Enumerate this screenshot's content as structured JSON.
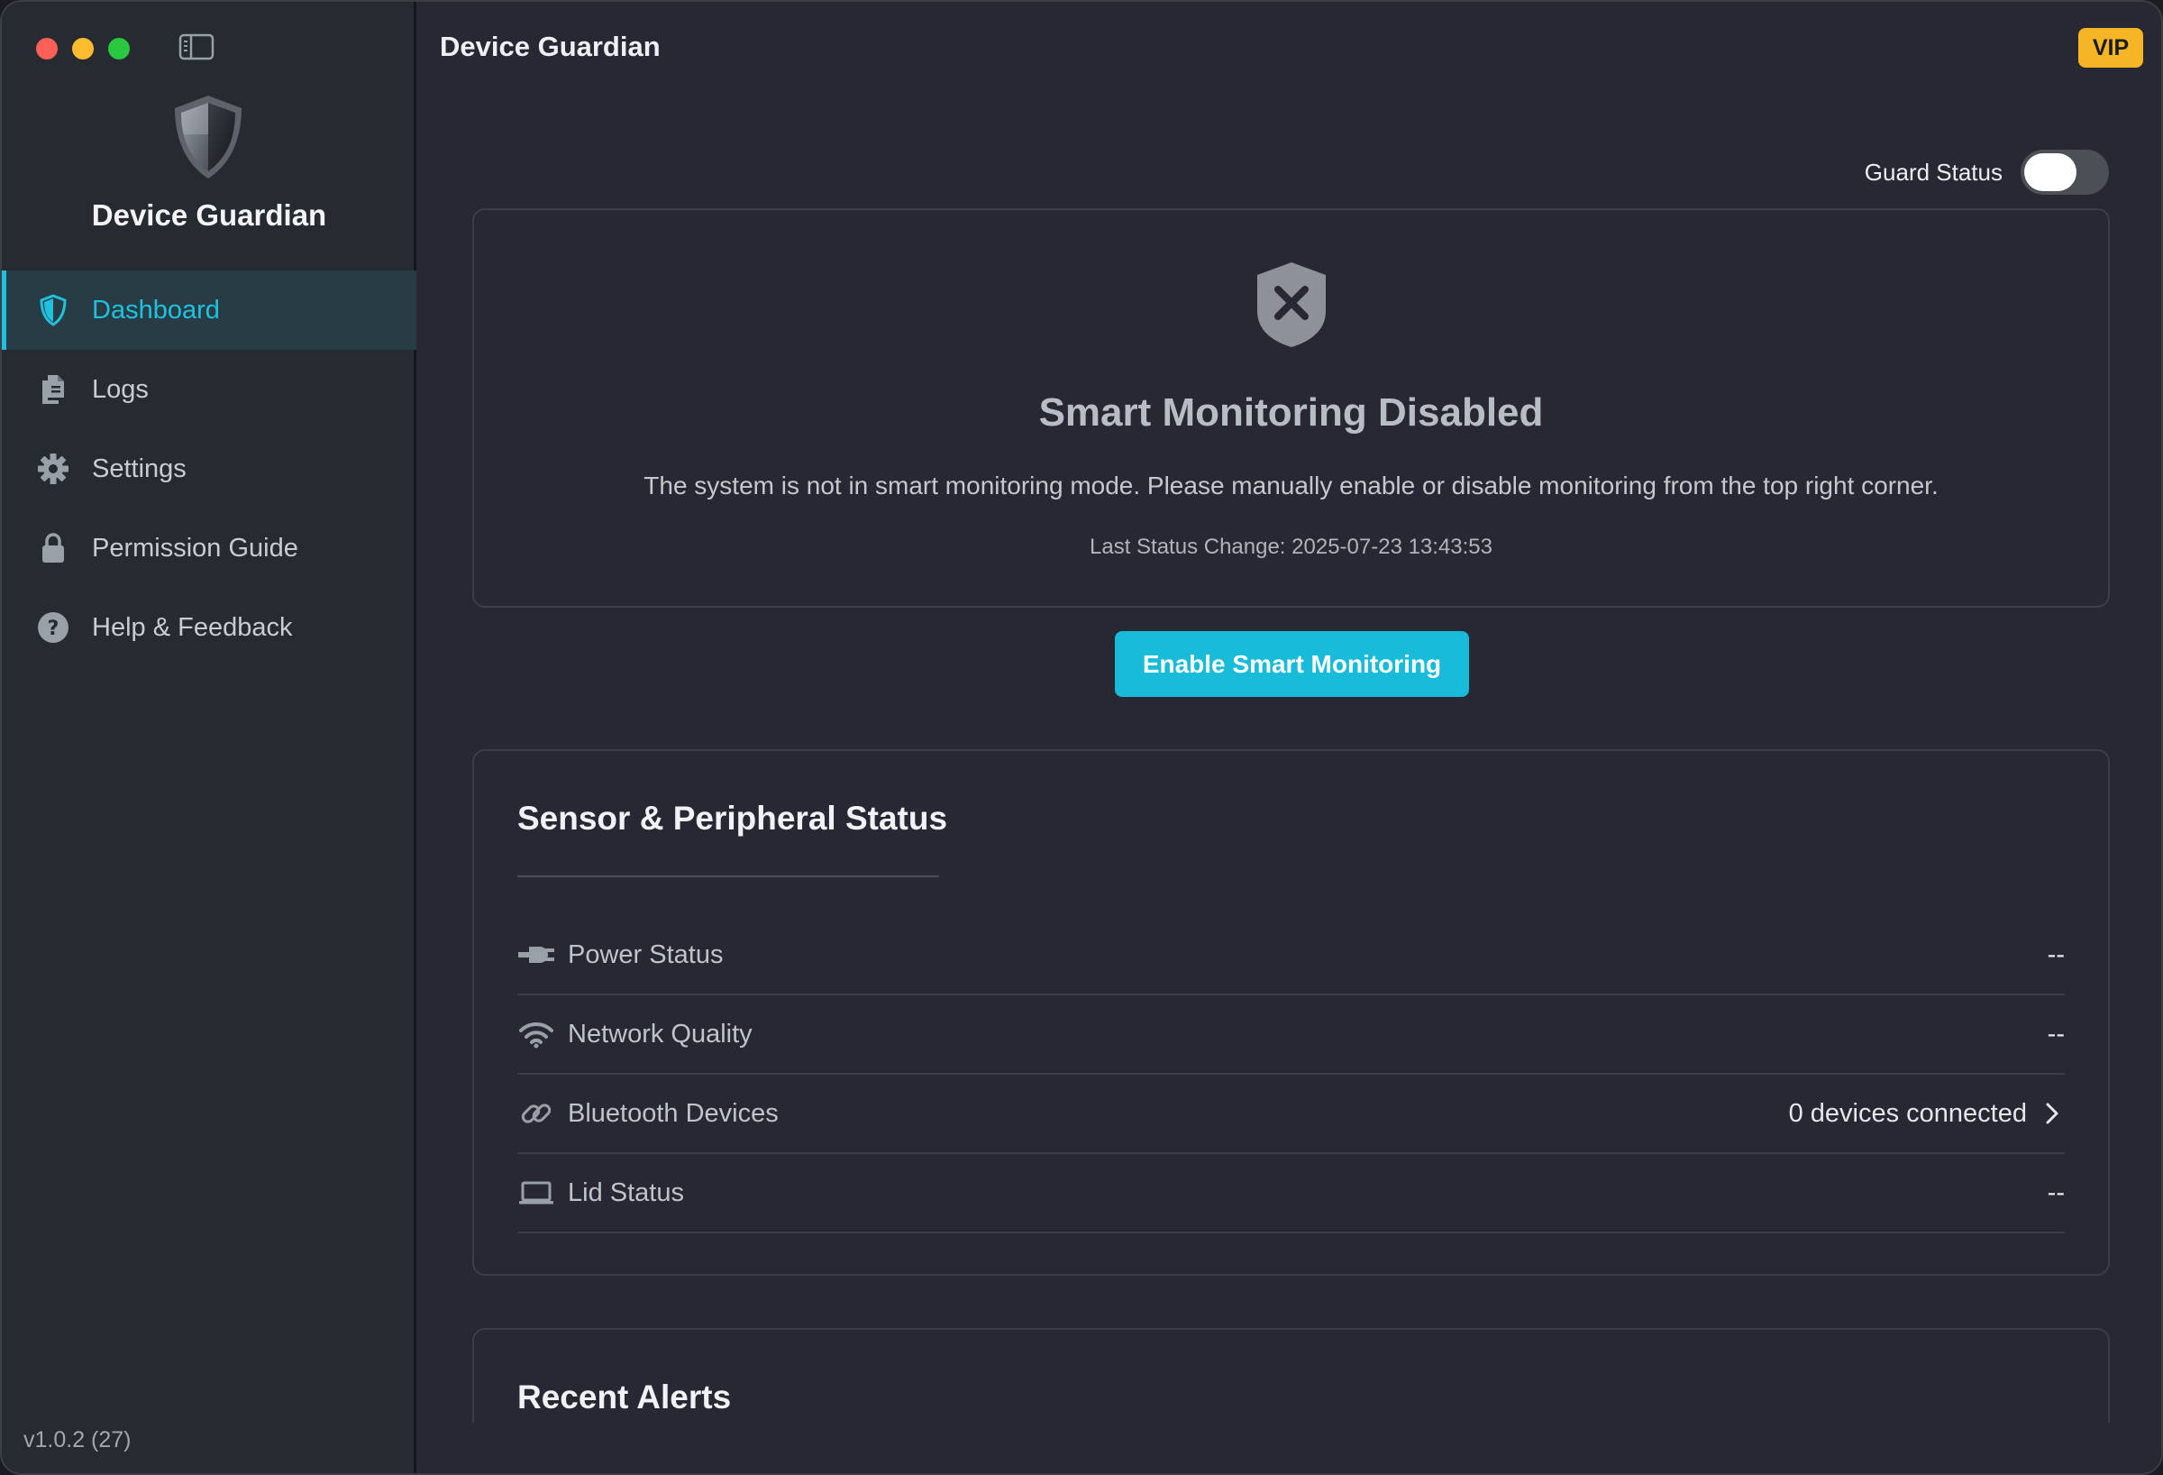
{
  "window": {
    "controls": [
      "close",
      "minimize",
      "zoom"
    ]
  },
  "sidebar": {
    "toggle_icon": "sidebar-toggle-icon",
    "brand_name": "Device Guardian",
    "brand_icon": "shield-logo-icon",
    "items": [
      {
        "label": "Dashboard",
        "icon": "shield-icon",
        "active": true
      },
      {
        "label": "Logs",
        "icon": "documents-icon",
        "active": false
      },
      {
        "label": "Settings",
        "icon": "gear-icon",
        "active": false
      },
      {
        "label": "Permission Guide",
        "icon": "lock-icon",
        "active": false
      },
      {
        "label": "Help & Feedback",
        "icon": "question-icon",
        "active": false
      }
    ],
    "version": "v1.0.2 (27)"
  },
  "header": {
    "title": "Device Guardian",
    "vip_badge": "VIP",
    "guard_status_label": "Guard Status",
    "guard_status_on": false
  },
  "status_card": {
    "icon": "shield-x-icon",
    "title": "Smart Monitoring Disabled",
    "description": "The system is not in smart monitoring mode. Please manually enable or disable monitoring from the top right corner.",
    "last_change": "Last Status Change: 2025-07-23 13:43:53"
  },
  "enable_button": {
    "label": "Enable Smart Monitoring"
  },
  "sensors": {
    "title": "Sensor & Peripheral Status",
    "rows": [
      {
        "label": "Power Status",
        "value": "--",
        "icon": "power-plug-icon"
      },
      {
        "label": "Network Quality",
        "value": "--",
        "icon": "wifi-icon"
      },
      {
        "label": "Bluetooth Devices",
        "value": "0 devices connected",
        "icon": "link-icon"
      },
      {
        "label": "Lid Status",
        "value": "--",
        "icon": "laptop-icon"
      }
    ]
  },
  "alerts": {
    "title": "Recent Alerts"
  },
  "colors": {
    "accent": "#20c1de",
    "vip": "#f5b524",
    "window_bg": "#272833",
    "sidebar_bg": "#262b31"
  }
}
